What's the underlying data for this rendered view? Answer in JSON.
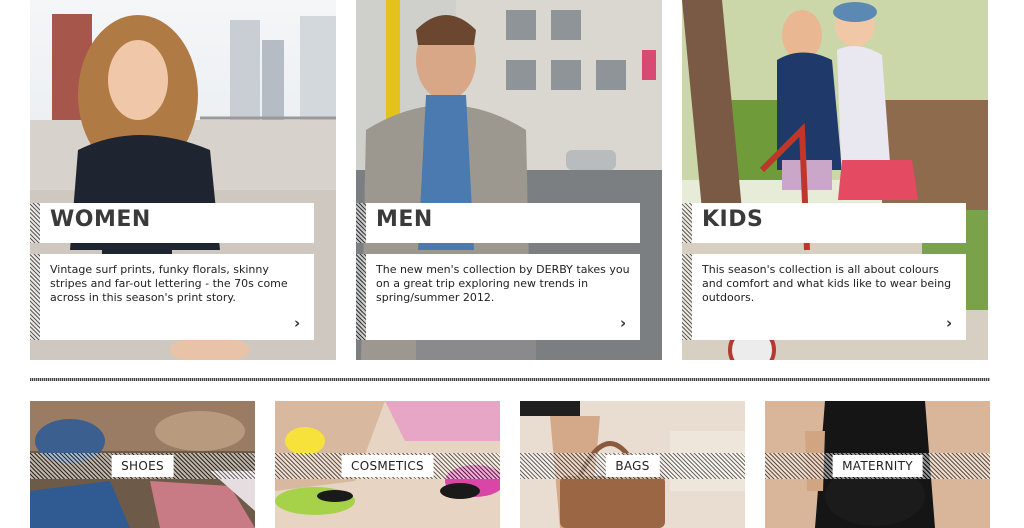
{
  "cards": [
    {
      "title": "WOMEN",
      "description": "Vintage surf prints, funky florals, skinny stripes and far-out lettering - the 70s come across in this season's print story.",
      "arrow": "›"
    },
    {
      "title": "MEN",
      "description": "The new men's collection by DERBY takes you on a great trip exploring new trends in spring/summer 2012.",
      "arrow": "›"
    },
    {
      "title": "KIDS",
      "description": "This season's collection is all about colours and comfort and what kids like to wear being outdoors.",
      "arrow": "›"
    }
  ],
  "tiles": [
    {
      "label": "SHOES"
    },
    {
      "label": "COSMETICS"
    },
    {
      "label": "BAGS"
    },
    {
      "label": "MATERNITY"
    }
  ]
}
